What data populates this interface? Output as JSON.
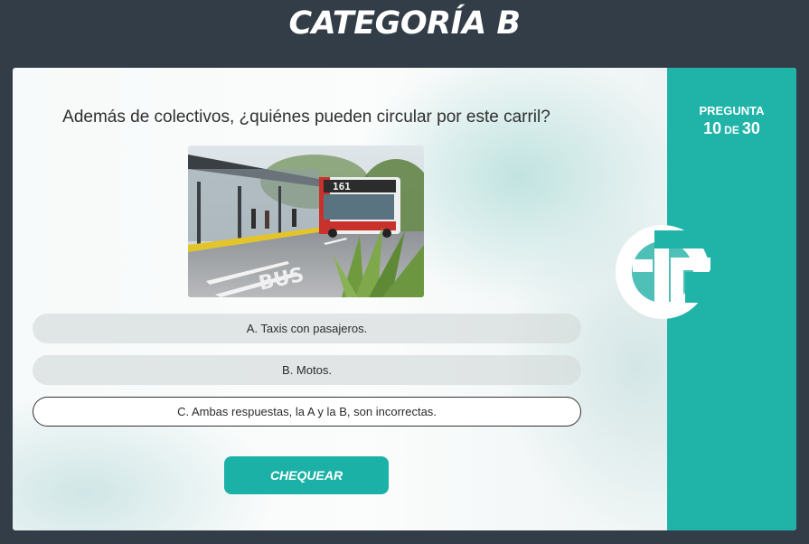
{
  "header": {
    "title": "CATEGORÍA B"
  },
  "quiz": {
    "question": "Además de colectivos, ¿quiénes pueden circular por este carril?",
    "image_label": "bus-lane-photo",
    "answers": [
      {
        "label": "A. Taxis con pasajeros.",
        "selected": false
      },
      {
        "label": "B. Motos.",
        "selected": false
      },
      {
        "label": "C. Ambas respuestas, la A y la B, son incorrectas.",
        "selected": true
      }
    ],
    "check_label": "CHEQUEAR"
  },
  "progress": {
    "label": "PREGUNTA",
    "current": "10",
    "separator": "DE",
    "total": "30"
  },
  "photo": {
    "bus_number": "161",
    "lane_text": "BUS"
  },
  "colors": {
    "background": "#333d47",
    "accent": "#20b3a8",
    "button": "#1cb1a7"
  }
}
